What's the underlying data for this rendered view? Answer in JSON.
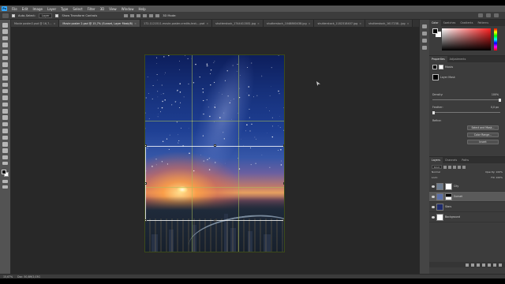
{
  "app": {
    "logo": "Ps"
  },
  "menu": [
    "File",
    "Edit",
    "Image",
    "Layer",
    "Type",
    "Select",
    "Filter",
    "3D",
    "View",
    "Window",
    "Help"
  ],
  "options": {
    "auto_select_label": "Auto-Select:",
    "auto_select_value": "Layer",
    "show_transform_label": "Show Transform Controls",
    "mode_label": "3D Mode:"
  },
  "tabs": [
    {
      "label": "Movie poster2.psd @ 16,7...",
      "active": false
    },
    {
      "label": "Movie poster 2.psd @ 15,7% (Sunset, Layer Mask/8)",
      "active": true
    },
    {
      "label": "172-1121511-movie-poster-credits-text-...psd",
      "active": false
    },
    {
      "label": "shutterstock_1744411581.jpg",
      "active": false
    },
    {
      "label": "shutterstock_1048860438.jpg",
      "active": false
    },
    {
      "label": "shutterstock_1182318407.jpg",
      "active": false
    },
    {
      "label": "shutterstock_1617238...jpg",
      "active": false
    }
  ],
  "status": {
    "zoom": "15,67%",
    "doc": "Doc: 50,8M/2,03G"
  },
  "color_panel": {
    "tabs": [
      "Color",
      "Swatches",
      "Gradients",
      "Patterns"
    ],
    "fg": "#000000",
    "bg": "#ffffff",
    "hue": "#ff2020"
  },
  "properties": {
    "tabs": [
      "Properties",
      "Adjustments"
    ],
    "title": "Masks",
    "layer_mask_label": "Layer Mask",
    "density_label": "Density:",
    "density_value": "100%",
    "feather_label": "Feather:",
    "feather_value": "0,0 px",
    "refine_label": "Refine:",
    "select_mask_btn": "Select and Mask...",
    "color_range_btn": "Color Range...",
    "invert_btn": "Invert"
  },
  "layers": {
    "tabs": [
      "Layers",
      "Channels",
      "Paths"
    ],
    "kind_label": "Kind",
    "blend_mode": "Normal",
    "opacity_label": "Opacity:",
    "opacity_value": "100%",
    "lock_label": "Lock:",
    "fill_label": "Fill:",
    "fill_value": "100%",
    "items": [
      {
        "name": "City",
        "active": false,
        "thumb": "#6d7c90",
        "has_mask": true
      },
      {
        "name": "Sunset",
        "active": true,
        "thumb": "#5b6fa8",
        "has_mask": true
      },
      {
        "name": "Stars",
        "active": false,
        "thumb": "#1f2b6b",
        "has_mask": false
      },
      {
        "name": "Background",
        "active": false,
        "thumb": "#ffffff",
        "has_mask": false
      }
    ]
  }
}
